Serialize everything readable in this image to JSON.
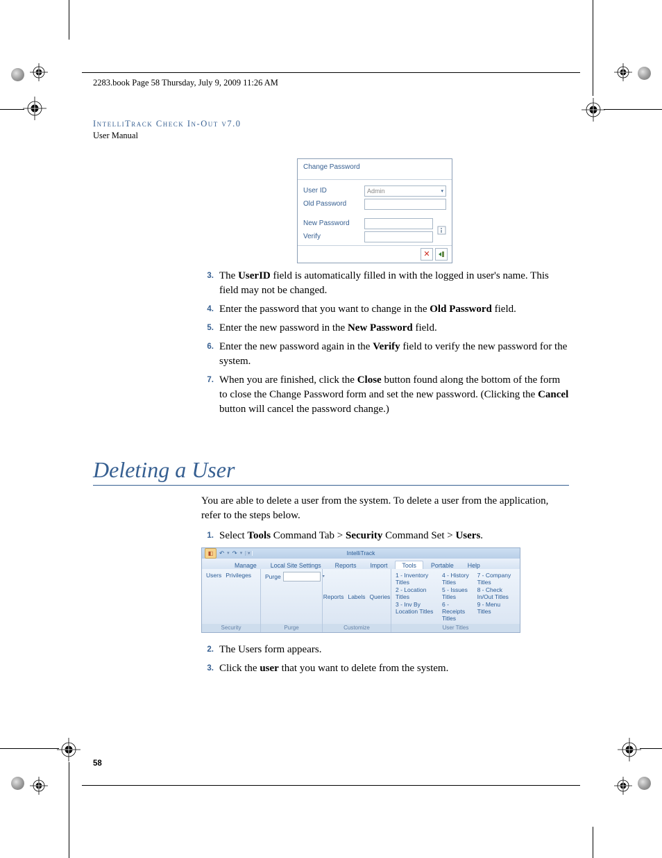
{
  "crop_header": "2283.book  Page 58  Thursday, July 9, 2009  11:26 AM",
  "running_head": {
    "line1": "IntelliTrack Check In-Out v7.0",
    "line2": "User Manual"
  },
  "dialog": {
    "title": "Change Password",
    "user_id_label": "User ID",
    "user_id_value": "Admin",
    "old_pw_label": "Old Password",
    "new_pw_label": "New Password",
    "verify_label": "Verify"
  },
  "steps_a": [
    {
      "n": "3.",
      "t_pre": "The ",
      "b1": "UserID",
      "t_mid": " field is automatically filled in with the logged in user's name. This field may not be changed."
    },
    {
      "n": "4.",
      "t_pre": "Enter the password that you want to change in the ",
      "b1": "Old Password",
      "t_mid": " field."
    },
    {
      "n": "5.",
      "t_pre": "Enter the new password in the ",
      "b1": "New Password",
      "t_mid": " field."
    },
    {
      "n": "6.",
      "t_pre": "Enter the new password again in the ",
      "b1": "Verify",
      "t_mid": " field to verify the new password for the system."
    },
    {
      "n": "7.",
      "t_pre": "When you are finished, click the ",
      "b1": "Close",
      "t_mid": " button found along the bottom of the form to close the Change Password form and set the new password. (Clicking the ",
      "b2": "Cancel",
      "t_end": " button will cancel the password change.)"
    }
  ],
  "section_title": "Deleting a User",
  "intro": "You are able to delete a user from the system. To delete a user from the application, refer to the steps below.",
  "steps_b": [
    {
      "n": "1.",
      "t_pre": "Select ",
      "b1": "Tools",
      "t_mid": " Command Tab > ",
      "b2": "Security",
      "t_mid2": " Command Set > ",
      "b3": "Users",
      "t_end": "."
    },
    {
      "n": "2.",
      "t_pre": "The Users form appears."
    },
    {
      "n": "3.",
      "t_pre": "Click the ",
      "b1": "user",
      "t_mid": " that you want to delete from the system."
    }
  ],
  "ribbon": {
    "app_title": "IntelliTrack",
    "tabs": [
      "Manage",
      "Local Site Settings",
      "Reports",
      "Import",
      "Tools",
      "Portable",
      "Help"
    ],
    "active_tab": "Tools",
    "group_security": {
      "label": "Security",
      "items": [
        "Users",
        "Privileges"
      ]
    },
    "group_purge": {
      "label": "Purge",
      "dd_label": "Purge"
    },
    "group_customize": {
      "label": "Customize",
      "items": [
        "Reports",
        "Labels",
        "Queries"
      ]
    },
    "group_titles": {
      "label": "User Titles",
      "col1": [
        "1 - Inventory Titles",
        "2 - Location Titles",
        "3 - Inv By Location Titles"
      ],
      "col2": [
        "4 - History Titles",
        "5 - Issues Titles",
        "6 - Receipts Titles"
      ],
      "col3": [
        "7 - Company Titles",
        "8 - Check In/Out Titles",
        "9 - Menu Titles"
      ]
    }
  },
  "page_number": "58"
}
